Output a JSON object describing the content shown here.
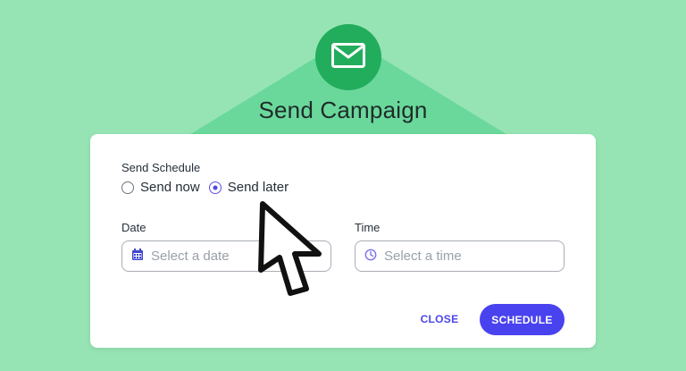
{
  "hero": {
    "icon": "mail-icon",
    "title": "Send Campaign"
  },
  "send_schedule": {
    "label": "Send Schedule",
    "options": [
      {
        "label": "Send now",
        "selected": false
      },
      {
        "label": "Send later",
        "selected": true
      }
    ]
  },
  "date": {
    "label": "Date",
    "placeholder": "Select a date",
    "icon": "calendar-icon"
  },
  "time": {
    "label": "Time",
    "placeholder": "Select a time",
    "icon": "clock-icon"
  },
  "actions": {
    "close": "CLOSE",
    "schedule": "SCHEDULE"
  },
  "colors": {
    "background": "#96e4b4",
    "triangle": "#6ad89b",
    "badge": "#22ad5c",
    "accent": "#4942ef",
    "text": "#1f2b2a"
  }
}
